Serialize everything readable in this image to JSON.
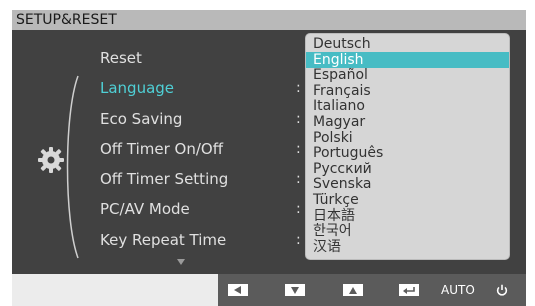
{
  "title": "SETUP&RESET",
  "menu_items": [
    {
      "label": "Reset"
    },
    {
      "label": "Language",
      "active": true
    },
    {
      "label": "Eco Saving"
    },
    {
      "label": "Off Timer On/Off"
    },
    {
      "label": "Off Timer Setting"
    },
    {
      "label": "PC/AV Mode"
    },
    {
      "label": "Key Repeat Time"
    }
  ],
  "language_options": [
    "Deutsch",
    "English",
    "Español",
    "Français",
    "Italiano",
    "Magyar",
    "Polski",
    "Português",
    "Русский",
    "Svenska",
    "Türkçe",
    "日本語",
    "한국어",
    "汉语"
  ],
  "selected_language": "English",
  "buttons": {
    "left_icon": "left-arrow-icon",
    "down_icon": "down-arrow-icon",
    "up_icon": "up-arrow-icon",
    "enter_icon": "enter-icon",
    "auto_label": "AUTO",
    "power_icon": "power-icon"
  },
  "colors": {
    "accent": "#47bcc4",
    "active_text": "#4fd0d6",
    "panel": "#414141"
  }
}
